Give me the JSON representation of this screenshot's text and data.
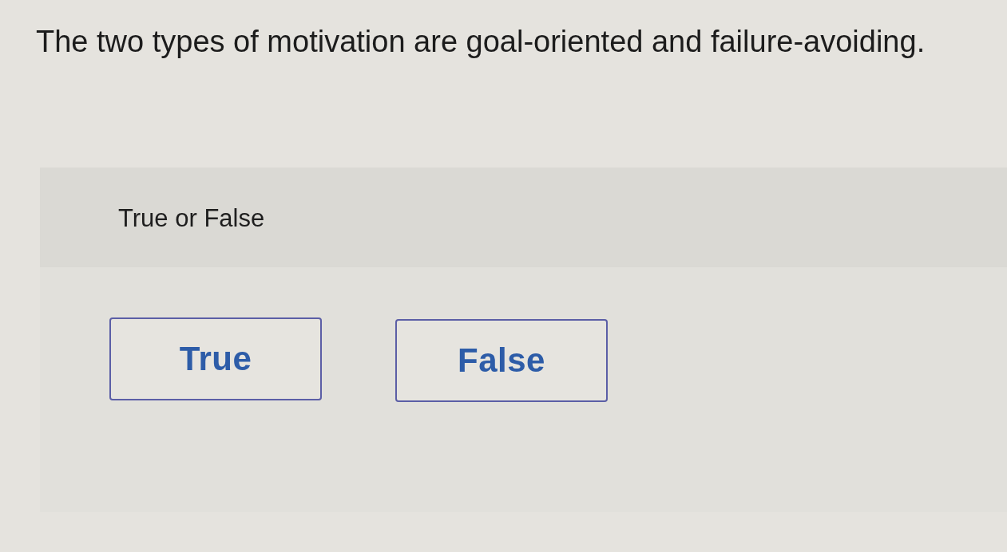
{
  "question": {
    "text": "The two types of motivation are goal-oriented and failure-avoiding."
  },
  "answer_panel": {
    "instruction": "True or False",
    "options": [
      {
        "label": "True",
        "selected": false
      },
      {
        "label": "False",
        "selected": false
      }
    ]
  }
}
